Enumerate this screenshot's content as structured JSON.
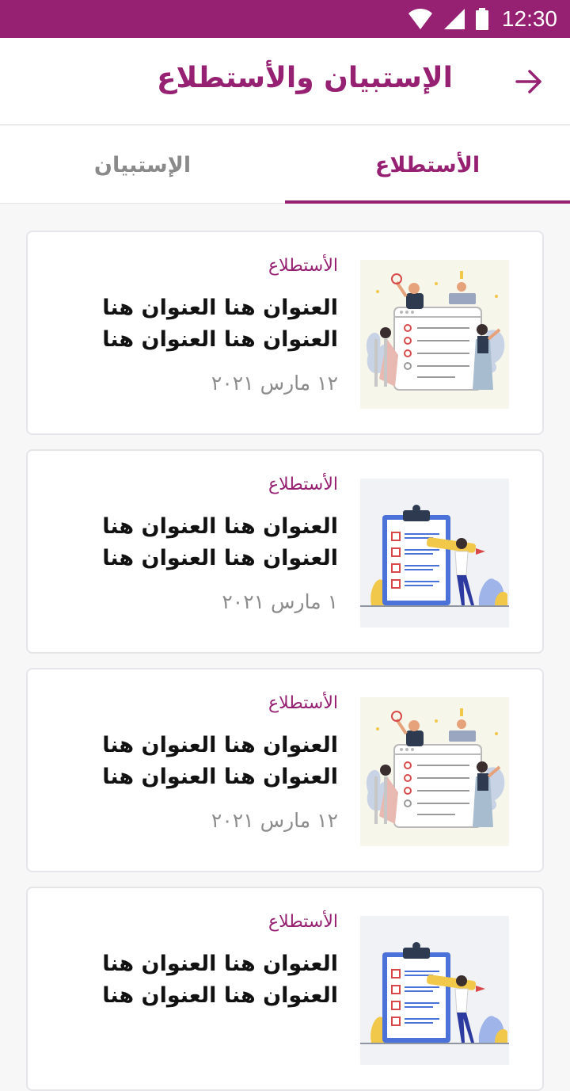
{
  "status_bar": {
    "time": "12:30",
    "icons": [
      "wifi-icon",
      "signal-icon",
      "battery-icon"
    ]
  },
  "header": {
    "title": "الإستبيان والأستطلاع",
    "back_icon": "arrow-right-icon"
  },
  "tabs": [
    {
      "label": "الأستطلاع",
      "active": true
    },
    {
      "label": "الإستبيان",
      "active": false
    }
  ],
  "cards": [
    {
      "tag": "الأستطلاع",
      "title": "العنوان هنا العنوان هنا العنوان هنا العنوان هنا",
      "date": "١٢ مارس ٢٠٢١",
      "image": "survey-team-illustration"
    },
    {
      "tag": "الأستطلاع",
      "title": "العنوان هنا العنوان هنا العنوان هنا العنوان هنا",
      "date": "١ مارس ٢٠٢١",
      "image": "checklist-clipboard-illustration"
    },
    {
      "tag": "الأستطلاع",
      "title": "العنوان هنا العنوان هنا العنوان هنا العنوان هنا",
      "date": "١٢ مارس ٢٠٢١",
      "image": "survey-team-illustration"
    },
    {
      "tag": "الأستطلاع",
      "title": "العنوان هنا العنوان هنا العنوان هنا العنوان هنا",
      "image": "checklist-clipboard-illustration"
    }
  ],
  "colors": {
    "primary": "#962071",
    "background": "#f7f7f8",
    "card_border": "#e6e6ea",
    "muted_text": "#8c8c8c"
  }
}
